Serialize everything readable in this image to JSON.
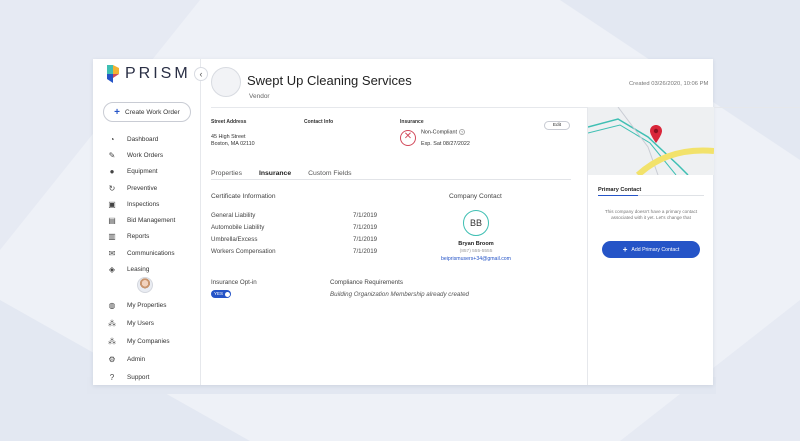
{
  "app": {
    "name": "PRISM"
  },
  "sidebar": {
    "create_label": "Create Work Order",
    "items": [
      {
        "label": "Dashboard",
        "icon": "gauge-icon"
      },
      {
        "label": "Work Orders",
        "icon": "wrench-icon"
      },
      {
        "label": "Equipment",
        "icon": "equipment-icon"
      },
      {
        "label": "Preventive",
        "icon": "preventive-icon"
      },
      {
        "label": "Inspections",
        "icon": "inspection-icon"
      },
      {
        "label": "Bid Management",
        "icon": "bid-icon"
      },
      {
        "label": "Reports",
        "icon": "reports-icon"
      },
      {
        "label": "Communications",
        "icon": "communications-icon"
      },
      {
        "label": "Leasing",
        "icon": "leasing-icon"
      }
    ],
    "bottom_items": [
      {
        "label": "My Properties",
        "icon": "globe-icon"
      },
      {
        "label": "My Users",
        "icon": "users-icon"
      },
      {
        "label": "My Companies",
        "icon": "companies-icon"
      },
      {
        "label": "Admin",
        "icon": "gear-icon"
      },
      {
        "label": "Support",
        "icon": "help-icon"
      }
    ]
  },
  "header": {
    "company_name": "Swept Up Cleaning Services",
    "company_type": "Vendor",
    "created": "Created 03/26/2020, 10:06 PM"
  },
  "info": {
    "street_label": "Street Address",
    "street_line1": "45 High Street",
    "street_line2": "Boston, MA 02110",
    "contact_label": "Contact Info",
    "insurance_label": "Insurance",
    "insurance_status": "Non-Compliant",
    "insurance_exp": "Exp. Sat 08/27/2022",
    "edit_label": "Edit"
  },
  "tabs": [
    {
      "label": "Properties",
      "active": false
    },
    {
      "label": "Insurance",
      "active": true
    },
    {
      "label": "Custom Fields",
      "active": false
    }
  ],
  "certificate": {
    "title": "Certificate Information",
    "rows": [
      {
        "name": "General Liability",
        "date": "7/1/2019"
      },
      {
        "name": "Automobile Liability",
        "date": "7/1/2019"
      },
      {
        "name": "Umbrella/Excess",
        "date": "7/1/2019"
      },
      {
        "name": "Workers Compensation",
        "date": "7/1/2019"
      }
    ]
  },
  "company_contact": {
    "title": "Company Contact",
    "initials": "BB",
    "name": "Bryan Broom",
    "phone": "(857) 555-5555",
    "email": "beiprismusers+34@gmail.com"
  },
  "optin": {
    "title": "Insurance Opt-in",
    "toggle_label": "YES",
    "compliance_title": "Compliance Requirements",
    "compliance_text": "Building Organization Membership already created"
  },
  "primary_contact": {
    "title": "Primary Contact",
    "text": "This company doesn't have a primary contact associated with it yet. Let's change that",
    "button_label": "Add Primary Contact"
  },
  "colors": {
    "accent": "#2554c7",
    "error": "#d24a5b",
    "teal": "#3fbfb3",
    "map_pin": "#d9263a"
  }
}
